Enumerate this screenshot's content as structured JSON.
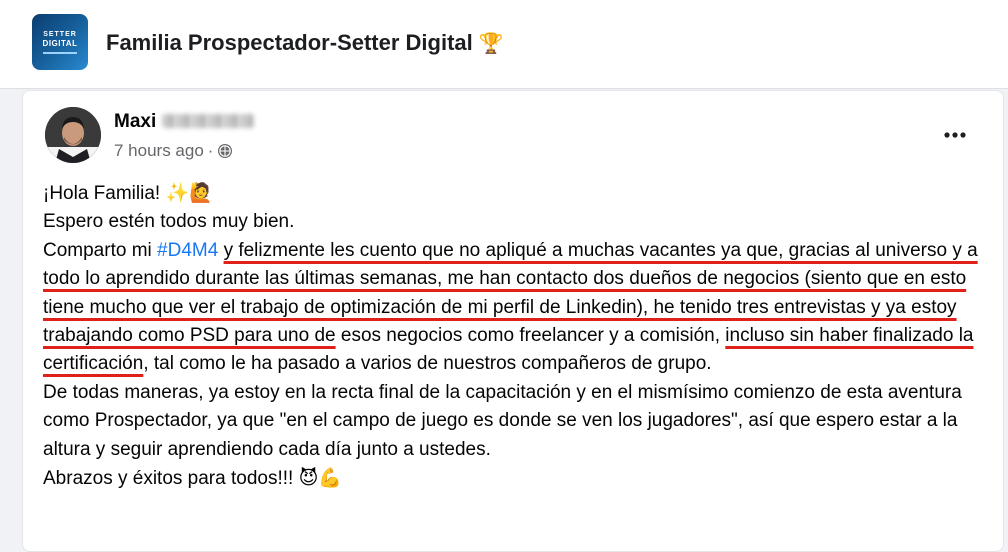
{
  "group": {
    "title": "Familia Prospectador-Setter Digital",
    "title_emoji": "🏆",
    "logo_text_top": "SETTER",
    "logo_text_bottom": "DIGITAL"
  },
  "post": {
    "author_first_name": "Maxi",
    "timestamp": "7 hours ago",
    "meta_separator": "·",
    "privacy_icon": "globe-icon",
    "more_icon": "more-options-icon",
    "body": {
      "greeting": "¡Hola Familia! ",
      "greeting_emoji": "✨🙋",
      "line2": "Espero estén todos muy bien.",
      "p3_a": "Comparto mi ",
      "hashtag": "#D4M4",
      "p3_b": " ",
      "p3_hl1": "y felizmente les cuento que no apliqué a muchas vacantes ya que, gracias al universo y a todo lo aprendido durante las últimas semanas, me han contacto dos dueños de negocios (siento que en esto tiene mucho que ver el trabajo de optimización de mi perfil de Linkedin), he tenido tres entrevistas y ya estoy trabajando como PSD para uno de",
      "p3_c": " esos negocios como freelancer y a comisión, ",
      "p3_hl2": "incluso sin haber finalizado la certificación",
      "p3_d": ", tal como le ha pasado a varios de nuestros compañeros de grupo.",
      "p4": "De todas maneras, ya estoy en la recta final de la capacitación y en el mismísimo comienzo de esta aventura como Prospectador, ya que \"en el campo de juego es donde se ven los jugadores\", así que espero estar a la altura y seguir aprendiendo cada día junto a ustedes.",
      "p5": "Abrazos y éxitos para todos!!! ",
      "p5_emoji": "😈💪"
    }
  },
  "colors": {
    "hashtag": "#1877f2",
    "highlight_underline": "#e0211a",
    "page_background": "#f0f2f5"
  }
}
